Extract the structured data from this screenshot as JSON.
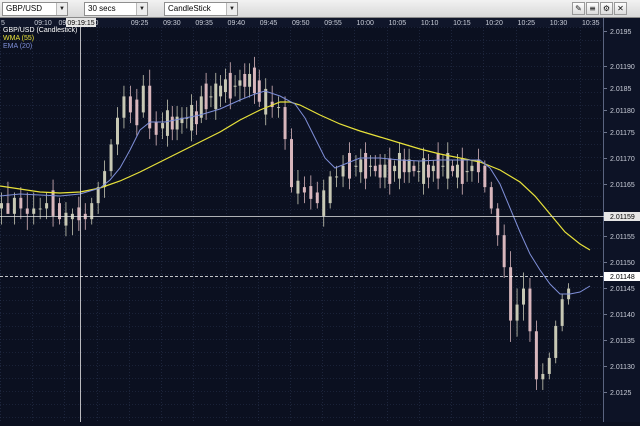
{
  "toolbar": {
    "symbol": "GBP/USD",
    "interval": "30 secs",
    "chart_type": "CandleStick"
  },
  "legend": {
    "title": "GBP/USD (Candlestick)",
    "wma": "WMA (55)",
    "ema": "EMA (20)"
  },
  "colors": {
    "background": "#0b1020",
    "grid": "#2a3450",
    "up_candle": "#c7c8b4",
    "down_candle": "#d8b6bc",
    "wma": "#e8e23a",
    "ema": "#7f8fd8",
    "crosshair": "#e6e6e6"
  },
  "time_axis": {
    "first_partial_label": "5",
    "labels": [
      "09:10",
      "09",
      "20",
      "09:25",
      "09:30",
      "09:35",
      "09:40",
      "09:45",
      "09:50",
      "09:55",
      "10:00",
      "10:05",
      "10:10",
      "10:15",
      "10:20",
      "10:25",
      "10:30",
      "10:35"
    ],
    "cursor_label": "09:19:15"
  },
  "price_axis": {
    "labels": [
      "2.0195",
      "2.01190",
      "2.0185",
      "2.01180",
      "2.01175",
      "2.01170",
      "2.01165",
      "2.01155",
      "2.01150",
      "2.01145",
      "2.01140",
      "2.01135",
      "2.01130",
      "2.0125"
    ],
    "crosshair_label": "2.01159",
    "last_price_label": "2.01148"
  },
  "chart_data": {
    "type": "candlestick",
    "symbol": "GBP/USD",
    "interval": "30 secs",
    "price_axis_ticks": [
      2.0195,
      2.0119,
      2.0185,
      2.0118,
      2.01175,
      2.0117,
      2.01165,
      2.01155,
      2.0115,
      2.01145,
      2.0114,
      2.01135,
      2.0113,
      2.0125
    ],
    "ylim": [
      2.01123,
      2.01197
    ],
    "crosshair": {
      "time": "09:19:15",
      "price": 2.01159
    },
    "last_price": 2.01148,
    "candles_approx": [
      {
        "t": "09:05",
        "o": 2.01163,
        "h": 2.01166,
        "l": 2.0116,
        "c": 2.01164
      },
      {
        "t": "09:06",
        "o": 2.01164,
        "h": 2.01168,
        "l": 2.01162,
        "c": 2.01162
      },
      {
        "t": "09:07",
        "o": 2.01162,
        "h": 2.01166,
        "l": 2.0116,
        "c": 2.01165
      },
      {
        "t": "09:08",
        "o": 2.01165,
        "h": 2.01167,
        "l": 2.01161,
        "c": 2.01163
      },
      {
        "t": "09:09",
        "o": 2.01163,
        "h": 2.01166,
        "l": 2.01159,
        "c": 2.01162
      },
      {
        "t": "09:10",
        "o": 2.01162,
        "h": 2.01166,
        "l": 2.0116,
        "c": 2.01163
      },
      {
        "t": "09:12",
        "o": 2.01163,
        "h": 2.01166,
        "l": 2.01161,
        "c": 2.01164
      },
      {
        "t": "09:14",
        "o": 2.01164,
        "h": 2.01165,
        "l": 2.0116,
        "c": 2.01161
      },
      {
        "t": "09:16",
        "o": 2.01161,
        "h": 2.01163,
        "l": 2.01158,
        "c": 2.01162
      },
      {
        "t": "09:18",
        "o": 2.01162,
        "h": 2.01164,
        "l": 2.01159,
        "c": 2.01161
      },
      {
        "t": "09:19",
        "o": 2.01161,
        "h": 2.01165,
        "l": 2.0116,
        "c": 2.01164
      },
      {
        "t": "09:20",
        "o": 2.01164,
        "h": 2.01168,
        "l": 2.01162,
        "c": 2.01167
      },
      {
        "t": "09:21",
        "o": 2.01167,
        "h": 2.01172,
        "l": 2.01165,
        "c": 2.0117
      },
      {
        "t": "09:22",
        "o": 2.0117,
        "h": 2.01176,
        "l": 2.01169,
        "c": 2.01175
      },
      {
        "t": "09:23",
        "o": 2.01175,
        "h": 2.01182,
        "l": 2.01173,
        "c": 2.0118
      },
      {
        "t": "09:24",
        "o": 2.0118,
        "h": 2.01186,
        "l": 2.01178,
        "c": 2.01184
      },
      {
        "t": "09:25",
        "o": 2.01184,
        "h": 2.01186,
        "l": 2.01179,
        "c": 2.01181
      },
      {
        "t": "09:27",
        "o": 2.01181,
        "h": 2.01188,
        "l": 2.0118,
        "c": 2.01186
      },
      {
        "t": "09:28",
        "o": 2.01186,
        "h": 2.01189,
        "l": 2.01176,
        "c": 2.01178
      },
      {
        "t": "09:30",
        "o": 2.01178,
        "h": 2.01181,
        "l": 2.01176,
        "c": 2.01179
      },
      {
        "t": "09:33",
        "o": 2.01179,
        "h": 2.01182,
        "l": 2.01177,
        "c": 2.0118
      },
      {
        "t": "09:36",
        "o": 2.0118,
        "h": 2.01186,
        "l": 2.01179,
        "c": 2.01184
      },
      {
        "t": "09:39",
        "o": 2.01184,
        "h": 2.01188,
        "l": 2.01182,
        "c": 2.01186
      },
      {
        "t": "09:42",
        "o": 2.01186,
        "h": 2.01189,
        "l": 2.01183,
        "c": 2.01187
      },
      {
        "t": "09:45",
        "o": 2.01187,
        "h": 2.01189,
        "l": 2.01182,
        "c": 2.01183
      },
      {
        "t": "09:47",
        "o": 2.01183,
        "h": 2.01186,
        "l": 2.0118,
        "c": 2.01182
      },
      {
        "t": "09:49",
        "o": 2.01182,
        "h": 2.01184,
        "l": 2.01174,
        "c": 2.01176
      },
      {
        "t": "09:50",
        "o": 2.01176,
        "h": 2.01178,
        "l": 2.01166,
        "c": 2.01167
      },
      {
        "t": "09:52",
        "o": 2.01167,
        "h": 2.01169,
        "l": 2.01164,
        "c": 2.01166
      },
      {
        "t": "09:54",
        "o": 2.01166,
        "h": 2.01168,
        "l": 2.01163,
        "c": 2.01164
      },
      {
        "t": "09:56",
        "o": 2.01164,
        "h": 2.0117,
        "l": 2.01163,
        "c": 2.01169
      },
      {
        "t": "09:58",
        "o": 2.01169,
        "h": 2.01173,
        "l": 2.01167,
        "c": 2.01171
      },
      {
        "t": "10:00",
        "o": 2.01171,
        "h": 2.01173,
        "l": 2.01169,
        "c": 2.01171
      },
      {
        "t": "10:03",
        "o": 2.01171,
        "h": 2.01173,
        "l": 2.01169,
        "c": 2.0117
      },
      {
        "t": "10:06",
        "o": 2.0117,
        "h": 2.01172,
        "l": 2.01168,
        "c": 2.01171
      },
      {
        "t": "10:09",
        "o": 2.01171,
        "h": 2.01172,
        "l": 2.01169,
        "c": 2.0117
      },
      {
        "t": "10:12",
        "o": 2.0117,
        "h": 2.01172,
        "l": 2.01168,
        "c": 2.01171
      },
      {
        "t": "10:15",
        "o": 2.01171,
        "h": 2.01172,
        "l": 2.01169,
        "c": 2.0117
      },
      {
        "t": "10:18",
        "o": 2.0117,
        "h": 2.01172,
        "l": 2.01168,
        "c": 2.01171
      },
      {
        "t": "10:20",
        "o": 2.01171,
        "h": 2.01172,
        "l": 2.01166,
        "c": 2.01167
      },
      {
        "t": "10:21",
        "o": 2.01167,
        "h": 2.01168,
        "l": 2.01162,
        "c": 2.01163
      },
      {
        "t": "10:22",
        "o": 2.01163,
        "h": 2.01164,
        "l": 2.01156,
        "c": 2.01158
      },
      {
        "t": "10:23",
        "o": 2.01158,
        "h": 2.0116,
        "l": 2.0115,
        "c": 2.01152
      },
      {
        "t": "10:24",
        "o": 2.01152,
        "h": 2.01155,
        "l": 2.01138,
        "c": 2.01142
      },
      {
        "t": "10:25",
        "o": 2.01142,
        "h": 2.01148,
        "l": 2.01139,
        "c": 2.01145
      },
      {
        "t": "10:26",
        "o": 2.01145,
        "h": 2.01151,
        "l": 2.01142,
        "c": 2.01148
      },
      {
        "t": "10:27",
        "o": 2.01148,
        "h": 2.0115,
        "l": 2.01138,
        "c": 2.0114
      },
      {
        "t": "10:28",
        "o": 2.0114,
        "h": 2.01142,
        "l": 2.01129,
        "c": 2.01131
      },
      {
        "t": "10:29",
        "o": 2.01131,
        "h": 2.01134,
        "l": 2.01129,
        "c": 2.01132
      },
      {
        "t": "10:30",
        "o": 2.01132,
        "h": 2.01136,
        "l": 2.01131,
        "c": 2.01135
      },
      {
        "t": "10:31",
        "o": 2.01135,
        "h": 2.01142,
        "l": 2.01134,
        "c": 2.01141
      },
      {
        "t": "10:32",
        "o": 2.01141,
        "h": 2.01147,
        "l": 2.0114,
        "c": 2.01146
      },
      {
        "t": "10:33",
        "o": 2.01146,
        "h": 2.01149,
        "l": 2.01145,
        "c": 2.01148
      }
    ]
  }
}
